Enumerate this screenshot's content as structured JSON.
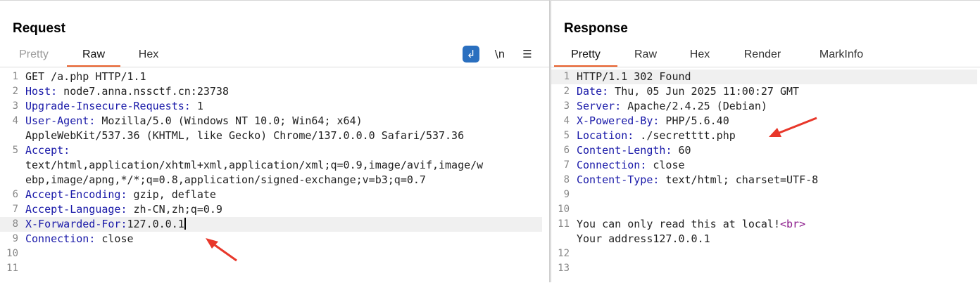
{
  "request": {
    "title": "Request",
    "tabs": [
      {
        "label": "Pretty",
        "active": false
      },
      {
        "label": "Raw",
        "active": true
      },
      {
        "label": "Hex",
        "active": false
      }
    ],
    "tools": {
      "newline_label": "\\n"
    },
    "lines": [
      {
        "num": "1",
        "name": "",
        "value": "GET /a.php HTTP/1.1"
      },
      {
        "num": "2",
        "name": "Host",
        "value": " node7.anna.nssctf.cn:23738"
      },
      {
        "num": "3",
        "name": "Upgrade-Insecure-Requests",
        "value": " 1"
      },
      {
        "num": "4",
        "name": "User-Agent",
        "value": " Mozilla/5.0 (Windows NT 10.0; Win64; x64)"
      },
      {
        "num": "",
        "name": "",
        "value": "AppleWebKit/537.36 (KHTML, like Gecko) Chrome/137.0.0.0 Safari/537.36"
      },
      {
        "num": "5",
        "name": "Accept",
        "value": ""
      },
      {
        "num": "",
        "name": "",
        "value": "text/html,application/xhtml+xml,application/xml;q=0.9,image/avif,image/w"
      },
      {
        "num": "",
        "name": "",
        "value": "ebp,image/apng,*/*;q=0.8,application/signed-exchange;v=b3;q=0.7"
      },
      {
        "num": "6",
        "name": "Accept-Encoding",
        "value": " gzip, deflate"
      },
      {
        "num": "7",
        "name": "Accept-Language",
        "value": " zh-CN,zh;q=0.9"
      },
      {
        "num": "8",
        "name": "X-Forwarded-For",
        "value": "127.0.0.1"
      },
      {
        "num": "9",
        "name": "Connection",
        "value": " close"
      },
      {
        "num": "10",
        "name": "",
        "value": ""
      },
      {
        "num": "11",
        "name": "",
        "value": ""
      }
    ]
  },
  "response": {
    "title": "Response",
    "tabs": [
      {
        "label": "Pretty",
        "active": true
      },
      {
        "label": "Raw",
        "active": false
      },
      {
        "label": "Hex",
        "active": false
      },
      {
        "label": "Render",
        "active": false
      },
      {
        "label": "MarkInfo",
        "active": false
      }
    ],
    "lines": [
      {
        "num": "1",
        "name": "",
        "value": "HTTP/1.1 302 Found"
      },
      {
        "num": "2",
        "name": "Date",
        "value": " Thu, 05 Jun 2025 11:00:27 GMT"
      },
      {
        "num": "3",
        "name": "Server",
        "value": " Apache/2.4.25 (Debian)"
      },
      {
        "num": "4",
        "name": "X-Powered-By",
        "value": " PHP/5.6.40"
      },
      {
        "num": "5",
        "name": "Location",
        "value": " ./secretttt.php"
      },
      {
        "num": "6",
        "name": "Content-Length",
        "value": " 60"
      },
      {
        "num": "7",
        "name": "Connection",
        "value": " close"
      },
      {
        "num": "8",
        "name": "Content-Type",
        "value": " text/html; charset=UTF-8"
      },
      {
        "num": "9",
        "name": "",
        "value": ""
      },
      {
        "num": "10",
        "name": "",
        "value": ""
      },
      {
        "num": "11",
        "name": "",
        "value": "You can only read this at local!",
        "tag": "<br>"
      },
      {
        "num": "",
        "name": "",
        "value": "Your address127.0.0.1"
      },
      {
        "num": "12",
        "name": "",
        "value": ""
      },
      {
        "num": "13",
        "name": "",
        "value": ""
      }
    ]
  },
  "colors": {
    "accent": "#e8602c",
    "header_name": "#1818a8",
    "annotation_arrow": "#e8372a"
  }
}
